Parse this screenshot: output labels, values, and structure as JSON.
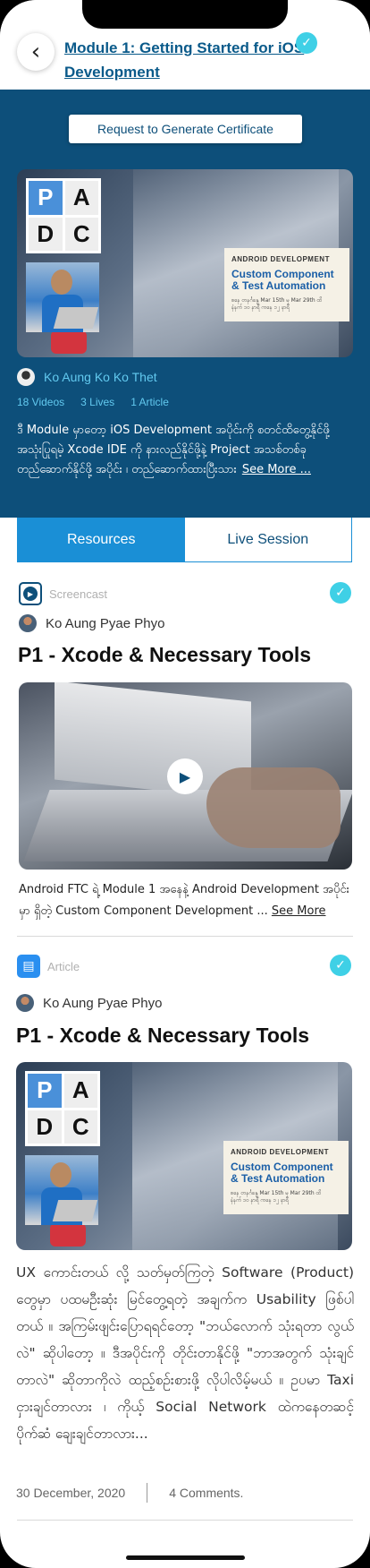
{
  "header": {
    "back_icon": "chevron-left-icon",
    "title": "Module 1: Getting Started for iOS Development",
    "completed_icon": "check-circle-icon"
  },
  "hero": {
    "certificate_button": "Request to Generate Certificate",
    "thumbnail": {
      "logo_letters": [
        "P",
        "A",
        "D",
        "C"
      ],
      "promo_heading": "ANDROID DEVELOPMENT",
      "promo_title_line1": "Custom Component",
      "promo_title_line2": "& Test Automation",
      "promo_date_line1": "စနေ တနင်္ဂနွေ Mar 15th မှ Mar 29th ထိ",
      "promo_date_line2": "နံနက် ၁၀ နာရီ ကနေ ၁၂ နာရီ"
    },
    "instructor_name": "Ko Aung Ko Ko Thet",
    "stats": {
      "videos": "18 Videos",
      "lives": "3 Lives",
      "articles": "1 Article"
    },
    "description": "ဒီ Module မှာတော့ iOS Development အပိုင်းကို စတင်ထိတွေ့နိုင်ဖို့ အသုံးပြုရမဲ့ Xcode IDE ကို နားလည်နိုင်ဖို့နဲ့ Project အသစ်တစ်ခု တည်ဆောက်နိုင်ဖို့ အပိုင်း ၊ တည်ဆောက်ထားပြီးသား",
    "see_more": "See More ..."
  },
  "tabs": [
    {
      "label": "Resources",
      "active": true
    },
    {
      "label": "Live Session",
      "active": false
    }
  ],
  "screencast_card": {
    "type_label": "Screencast",
    "type_icon": "play-circle-icon",
    "author": "Ko Aung Pyae Phyo",
    "title": "P1 - Xcode & Necessary Tools",
    "play_icon": "play-icon",
    "caption": "Android FTC ရဲ့ Module 1 အနေနဲ့ Android Development အပိုင်းမှာ ရှိတဲ့ Custom Component Development ...",
    "see_more": "See More"
  },
  "article_card": {
    "type_label": "Article",
    "type_icon": "book-icon",
    "author": "Ko Aung Pyae Phyo",
    "title": "P1 - Xcode & Necessary Tools",
    "body": "UX ကောင်းတယ် လို့ သတ်မှတ်ကြတဲ့ Software (Product) တွေမှာ ပထမဦးဆုံး မြင်တွေ့ရတဲ့ အချက်က Usability ဖြစ်ပါတယ် ။ အကြမ်းဖျင်းပြောရရင်တော့ \"ဘယ်လောက် သုံးရတာ လွယ်လဲ\" ဆိုပါတော့ ။ ဒီအပိုင်းကို တိုင်းတာနိုင်ဖို့ \"ဘာအတွက် သုံးချင်တာလဲ\" ဆိုတာကိုလဲ ထည့်စဉ်းစားဖို့ လိုပါလိမ့်မယ် ။ ဥပမာ Taxi ငှားချင်တာလား ၊ ကိုယ့် Social Network ထဲကနေတဆင့် ပိုက်ဆံ ချေးချင်တာလား...",
    "date": "30 December, 2020",
    "comments": "4 Comments."
  },
  "colors": {
    "hero_bg": "#0d4f7a",
    "accent_blue": "#1a8fd6",
    "link_cyan": "#62c9ef",
    "check_cyan": "#3fd0e6"
  }
}
